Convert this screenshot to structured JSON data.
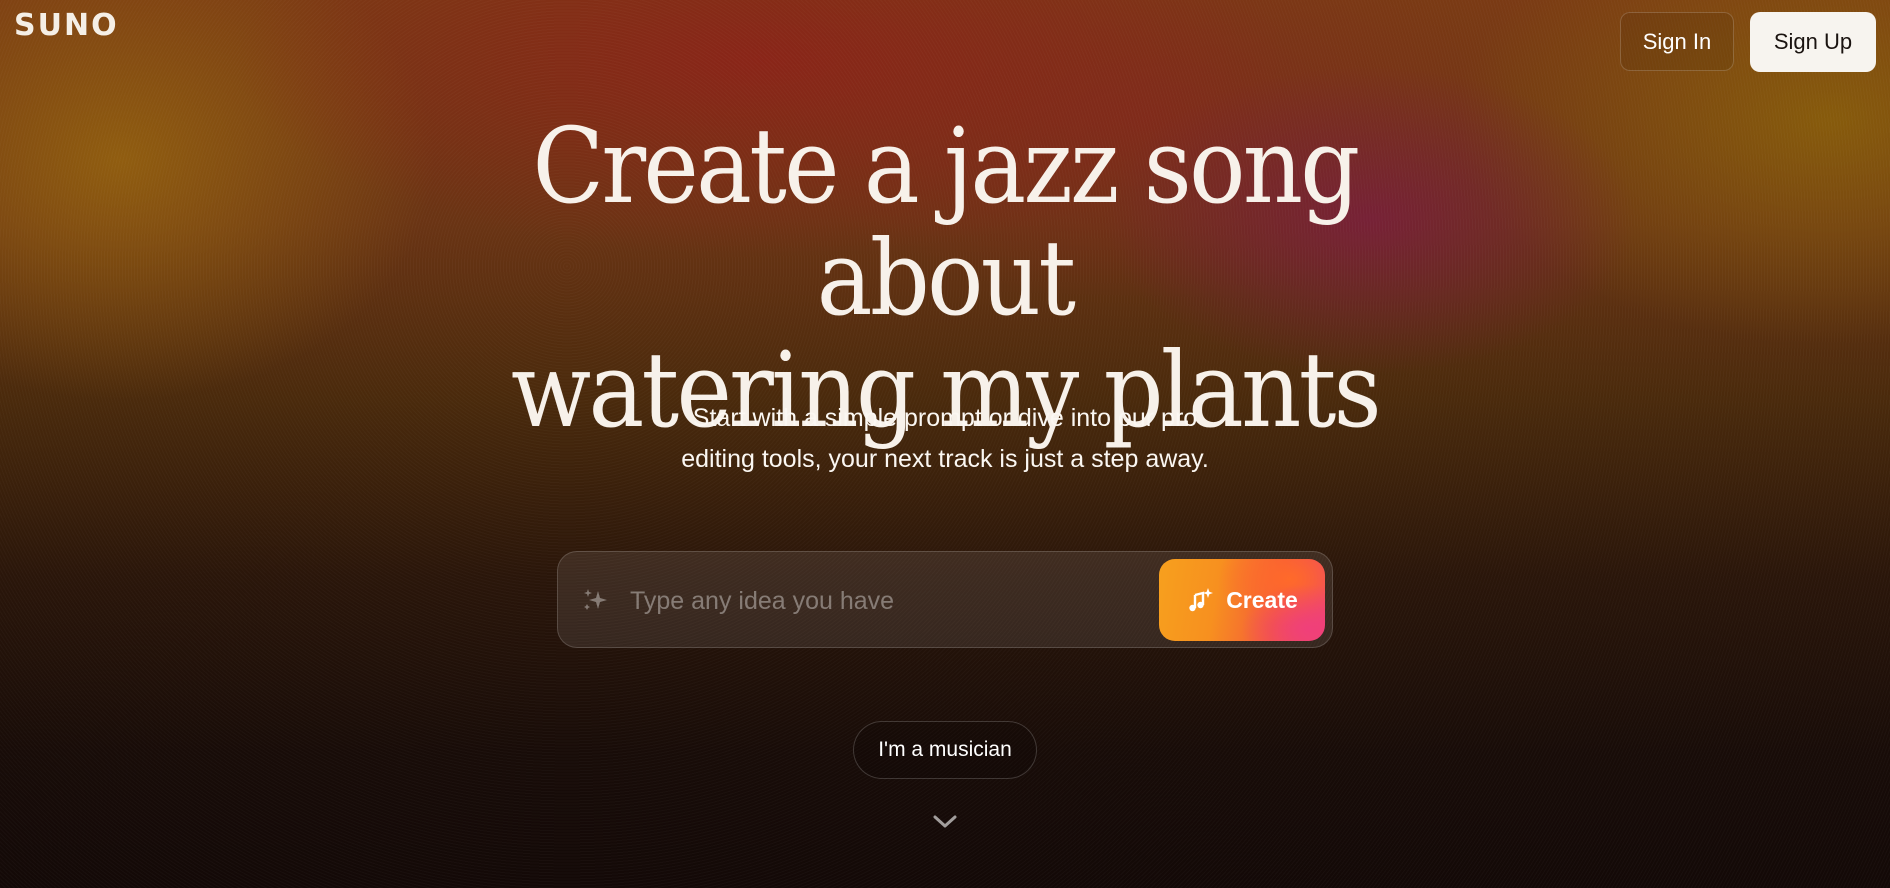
{
  "header": {
    "logo": "SUNO",
    "sign_in_label": "Sign In",
    "sign_up_label": "Sign Up"
  },
  "hero": {
    "headline_line1": "Create a jazz song about",
    "headline_line2": "watering my plants",
    "subtext_line1": "Start with a simple prompt or dive into our pro",
    "subtext_line2": "editing tools, your next track is just a step away."
  },
  "prompt": {
    "placeholder": "Type any idea you have",
    "value": "",
    "create_label": "Create",
    "sparkle_icon": "sparkle-icon",
    "create_icon": "music-note-sparkle-icon"
  },
  "secondary": {
    "musician_label": "I'm a musician",
    "scroll_icon": "chevron-down-icon"
  },
  "colors": {
    "accent_gradient_start": "#f7a01e",
    "accent_gradient_end": "#ec3f78",
    "sign_up_bg": "#f7f4ef",
    "headline_color": "#f7f1ea"
  }
}
